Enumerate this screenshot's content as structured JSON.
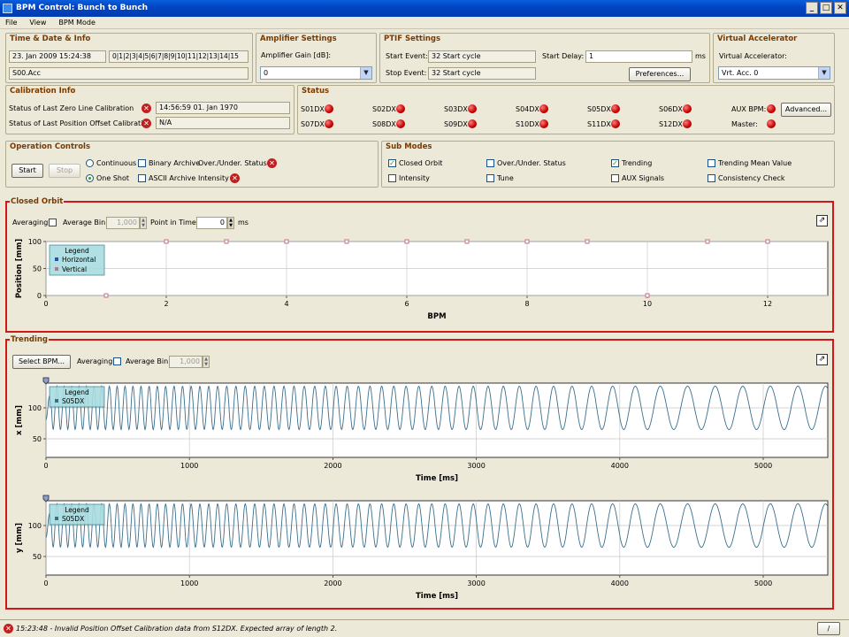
{
  "window": {
    "title": "BPM Control: Bunch to Bunch",
    "minimize": "_",
    "maximize": "□",
    "close": "✕"
  },
  "menu": {
    "items": [
      "File",
      "View",
      "BPM Mode"
    ]
  },
  "time_date": {
    "title": "Time & Date & Info",
    "datetime": "23. Jan 2009 15:24:38",
    "bunches": "0|1|2|3|4|5|6|7|8|9|10|11|12|13|14|15",
    "accelerator": "S00.Acc"
  },
  "amplifier": {
    "title": "Amplifier Settings",
    "gain_label": "Amplifier Gain [dB]:",
    "gain_value": "0"
  },
  "ptif": {
    "title": "PTIF Settings",
    "start_event_label": "Start Event:",
    "start_event": "32 Start cycle",
    "stop_event_label": "Stop Event:",
    "stop_event": "32 Start cycle",
    "start_delay_label": "Start Delay:",
    "start_delay": "1",
    "unit": "ms",
    "preferences_button": "Preferences..."
  },
  "virtual_accelerator": {
    "title": "Virtual Accelerator",
    "label": "Virtual Accelerator:",
    "value": "Vrt. Acc. 0"
  },
  "calibration": {
    "title": "Calibration Info",
    "zero_line_label": "Status of Last Zero Line Calibration",
    "zero_line_value": "14:56:59 01. Jan 1970",
    "offset_label": "Status of Last Position Offset Calibration",
    "offset_value": "N/A"
  },
  "status": {
    "title": "Status",
    "leds": [
      "S01DX",
      "S02DX",
      "S03DX",
      "S04DX",
      "S05DX",
      "S06DX",
      "S07DX",
      "S08DX",
      "S09DX",
      "S10DX",
      "S11DX",
      "S12DX"
    ],
    "aux_bpm_label": "AUX BPM:",
    "master_label": "Master:",
    "advanced_button": "Advanced..."
  },
  "operation": {
    "title": "Operation Controls",
    "start_button": "Start",
    "stop_button": "Stop",
    "continuous": "Continuous",
    "one_shot": "One Shot",
    "binary_archive": "Binary Archive",
    "ascii_archive": "ASCII Archive",
    "over_under": "Over./Under. Status",
    "intensity": "Intensity"
  },
  "submodes": {
    "title": "Sub Modes",
    "items": [
      {
        "label": "Closed Orbit",
        "checked": true
      },
      {
        "label": "Over./Under. Status",
        "checked": false
      },
      {
        "label": "Trending",
        "checked": true
      },
      {
        "label": "Trending Mean Value",
        "checked": false
      },
      {
        "label": "Intensity",
        "checked": false
      },
      {
        "label": "Tune",
        "checked": false
      },
      {
        "label": "AUX Signals",
        "checked": false
      },
      {
        "label": "Consistency Check",
        "checked": false
      }
    ]
  },
  "closed_orbit": {
    "title": "Closed Orbit",
    "averaging": "Averaging",
    "average_bin_label": "Average Bin:",
    "average_bin": "1,000",
    "point_in_time_label": "Point in Time:",
    "point_in_time": "0",
    "unit": "ms"
  },
  "trending": {
    "title": "Trending",
    "select_bpm_button": "Select BPM...",
    "averaging": "Averaging",
    "average_bin_label": "Average Bin:",
    "average_bin": "1,000"
  },
  "status_bar": {
    "message": "15:23:48 - Invalid Position Offset Calibration data from S12DX. Expected array of length 2.",
    "button": "/"
  },
  "chart_data": [
    {
      "type": "scatter",
      "xlabel": "BPM",
      "ylabel": "Position [mm]",
      "xlim": [
        0,
        13
      ],
      "ylim": [
        0,
        100
      ],
      "xticks": [
        0,
        2,
        4,
        6,
        8,
        10,
        12
      ],
      "yticks": [
        0,
        50,
        100
      ],
      "legend_title": "Legend",
      "legend_position": "top-left",
      "grid": true,
      "series": [
        {
          "name": "Horizontal",
          "color": "#2a4fb0",
          "x": [
            1,
            2,
            3,
            4,
            5,
            6,
            7,
            8,
            9,
            10,
            11,
            12
          ],
          "y": [
            0,
            100,
            100,
            100,
            100,
            100,
            100,
            100,
            100,
            0,
            100,
            100
          ]
        },
        {
          "name": "Vertical",
          "color": "#c27090",
          "x": [
            1,
            2,
            3,
            4,
            5,
            6,
            7,
            8,
            9,
            10,
            11,
            12
          ],
          "y": [
            0,
            100,
            100,
            100,
            100,
            100,
            100,
            100,
            100,
            0,
            100,
            100
          ]
        }
      ]
    },
    {
      "type": "line",
      "xlabel": "Time [ms]",
      "ylabel": "x [mm]",
      "xlim": [
        0,
        5450
      ],
      "ylim": [
        20,
        140
      ],
      "xticks": [
        0,
        1000,
        2000,
        3000,
        4000,
        5000
      ],
      "yticks": [
        50,
        100
      ],
      "legend_title": "Legend",
      "legend_position": "top-left",
      "grid": true,
      "series": [
        {
          "name": "S05DX",
          "color": "#3a6f8c",
          "center": 100,
          "amplitude": 35,
          "freq_start_per_ms": 0.02,
          "freq_end_per_ms": 0.0052
        }
      ]
    },
    {
      "type": "line",
      "xlabel": "Time [ms]",
      "ylabel": "y [mm]",
      "xlim": [
        0,
        5450
      ],
      "ylim": [
        20,
        140
      ],
      "xticks": [
        0,
        1000,
        2000,
        3000,
        4000,
        5000
      ],
      "yticks": [
        50,
        100
      ],
      "legend_title": "Legend",
      "legend_position": "top-left",
      "grid": true,
      "series": [
        {
          "name": "S05DX",
          "color": "#3a6f8c",
          "center": 100,
          "amplitude": 35,
          "freq_start_per_ms": 0.02,
          "freq_end_per_ms": 0.0052
        }
      ]
    }
  ]
}
